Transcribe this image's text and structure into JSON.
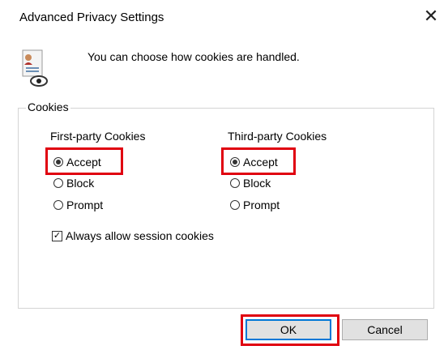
{
  "window": {
    "title": "Advanced Privacy Settings",
    "close_glyph": "✕"
  },
  "intro_text": "You can choose how cookies are handled.",
  "cookies_group": {
    "label": "Cookies",
    "first_party": {
      "title": "First-party Cookies",
      "options": [
        "Accept",
        "Block",
        "Prompt"
      ],
      "selected": "Accept"
    },
    "third_party": {
      "title": "Third-party Cookies",
      "options": [
        "Accept",
        "Block",
        "Prompt"
      ],
      "selected": "Accept"
    },
    "session_checkbox": {
      "label": "Always allow session cookies",
      "checked": true
    }
  },
  "buttons": {
    "ok": "OK",
    "cancel": "Cancel"
  },
  "colors": {
    "highlight": "#e00010",
    "default_button_border": "#0078d7"
  }
}
